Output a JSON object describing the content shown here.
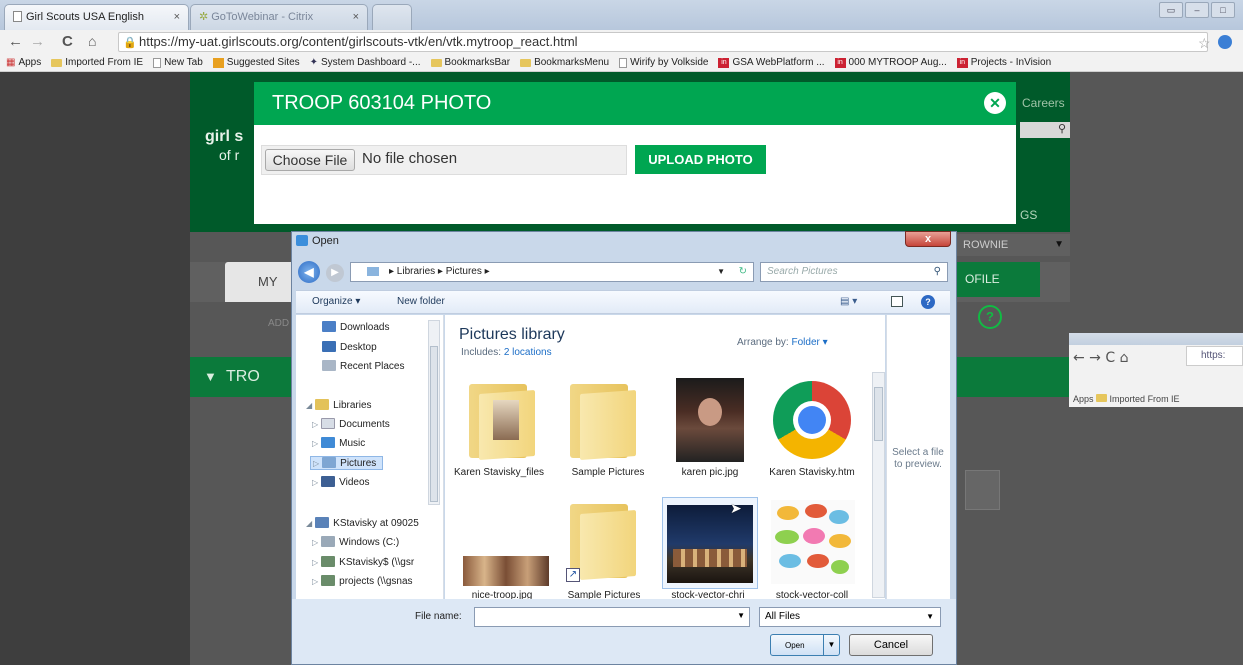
{
  "browser": {
    "tabs": [
      {
        "label": "Girl Scouts USA English",
        "close": "×"
      },
      {
        "label": "GoToWebinar - Citrix",
        "close": "×"
      }
    ],
    "url": "https://my-uat.girlscouts.org/content/girlscouts-vtk/en/vtk.mytroop_react.html",
    "bookmarks": [
      "Apps",
      "Imported From IE",
      "New Tab",
      "Suggested Sites",
      "System Dashboard -...",
      "BookmarksBar",
      "BookmarksMenu",
      "Wirify by Volkside",
      "GSA WebPlatform ...",
      "000 MYTROOP Aug...",
      "Projects - InVision"
    ]
  },
  "site": {
    "logo_line1": "girl s",
    "logo_line2": "of r",
    "careers": "Careers",
    "gs": "GS",
    "dropdown": "ROWNIE",
    "my_tab": "MY",
    "profile_tab": "OFILE",
    "add": "ADD",
    "troop_bar": "TRO",
    "help": "?"
  },
  "modal": {
    "title": "TROOP 603104 PHOTO",
    "close": "✕",
    "choose_file": "Choose File",
    "no_file": "No file chosen",
    "upload": "UPLOAD PHOTO"
  },
  "thumbnail": {
    "url": "https:",
    "apps": "Apps",
    "imported": "Imported From IE"
  },
  "dialog": {
    "title": "Open",
    "close": "x",
    "path": "▸ Libraries ▸ Pictures ▸",
    "search_placeholder": "Search Pictures",
    "organize": "Organize ▾",
    "new_folder": "New folder",
    "nav": [
      {
        "label": "Downloads",
        "color": "#4b7fc6"
      },
      {
        "label": "Desktop",
        "color": "#3a6fb5"
      },
      {
        "label": "Recent Places",
        "color": "#a9b6c6"
      },
      {
        "label": "Libraries",
        "color": "#e3c25a"
      },
      {
        "label": "Documents",
        "color": "#d7dde6"
      },
      {
        "label": "Music",
        "color": "#3f8ad6"
      },
      {
        "label": "Pictures",
        "color": "#7ea6d3"
      },
      {
        "label": "Videos",
        "color": "#3d5f93"
      },
      {
        "label": "KStavisky at 09025",
        "color": "#5a82b8"
      },
      {
        "label": "Windows (C:)",
        "color": "#9aa9b8"
      },
      {
        "label": "KStavisky$ (\\\\gsr",
        "color": "#6a8c6a"
      },
      {
        "label": "projects (\\\\gsnas",
        "color": "#6a8c6a"
      }
    ],
    "library_title": "Pictures library",
    "includes": "Includes:",
    "locations": "2 locations",
    "arrange_by": "Arrange by:",
    "arrange_value": "Folder ▾",
    "preview": "Select a file to preview.",
    "items": [
      {
        "label": "Karen Stavisky_files"
      },
      {
        "label": "Sample Pictures"
      },
      {
        "label": "karen pic.jpg"
      },
      {
        "label": "Karen Stavisky.htm"
      },
      {
        "label": "nice-troop.jpg"
      },
      {
        "label": "Sample Pictures"
      },
      {
        "label": "stock-vector-chri"
      },
      {
        "label": "stock-vector-coll"
      }
    ],
    "file_name_label": "File name:",
    "filter": "All Files",
    "open": "Open",
    "cancel": "Cancel"
  }
}
